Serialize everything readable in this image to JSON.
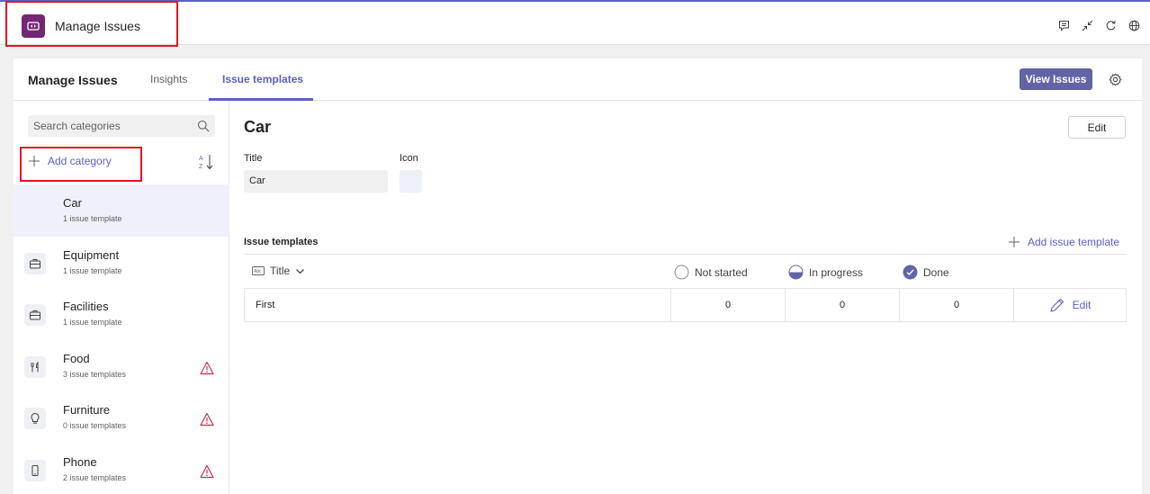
{
  "app": {
    "title": "Manage Issues",
    "accent_color": "#742774",
    "topbar_icons": [
      "chat-icon",
      "collapse-icon",
      "refresh-icon",
      "globe-icon"
    ]
  },
  "tabs": {
    "brand": "Manage Issues",
    "items": [
      {
        "label": "Insights",
        "active": false
      },
      {
        "label": "Issue templates",
        "active": true
      }
    ],
    "view_issues_label": "View Issues",
    "primary_color": "#6264a7"
  },
  "sidebar": {
    "search_placeholder": "Search categories",
    "add_category_label": "Add category",
    "categories": [
      {
        "name": "Car",
        "sub": "1 issue template",
        "icon": "none",
        "warning": false,
        "selected": true
      },
      {
        "name": "Equipment",
        "sub": "1 issue template",
        "icon": "briefcase-icon",
        "warning": false,
        "selected": false
      },
      {
        "name": "Facilities",
        "sub": "1 issue template",
        "icon": "briefcase-icon",
        "warning": false,
        "selected": false
      },
      {
        "name": "Food",
        "sub": "3 issue templates",
        "icon": "fork-knife-icon",
        "warning": true,
        "selected": false
      },
      {
        "name": "Furniture",
        "sub": "0 issue templates",
        "icon": "lightbulb-icon",
        "warning": true,
        "selected": false
      },
      {
        "name": "Phone",
        "sub": "2 issue templates",
        "icon": "phone-icon",
        "warning": true,
        "selected": false
      }
    ],
    "warning_color": "#c4314b"
  },
  "detail": {
    "title": "Car",
    "edit_label": "Edit",
    "title_label": "Title",
    "icon_label": "Icon",
    "title_value": "Car",
    "issue_templates_header": "Issue templates",
    "add_issue_template_label": "Add issue template",
    "columns": {
      "title": "Title",
      "not_started": "Not started",
      "in_progress": "In progress",
      "done": "Done"
    },
    "rows": [
      {
        "name": "First",
        "not_started": "0",
        "in_progress": "0",
        "done": "0",
        "edit_label": "Edit"
      }
    ]
  }
}
